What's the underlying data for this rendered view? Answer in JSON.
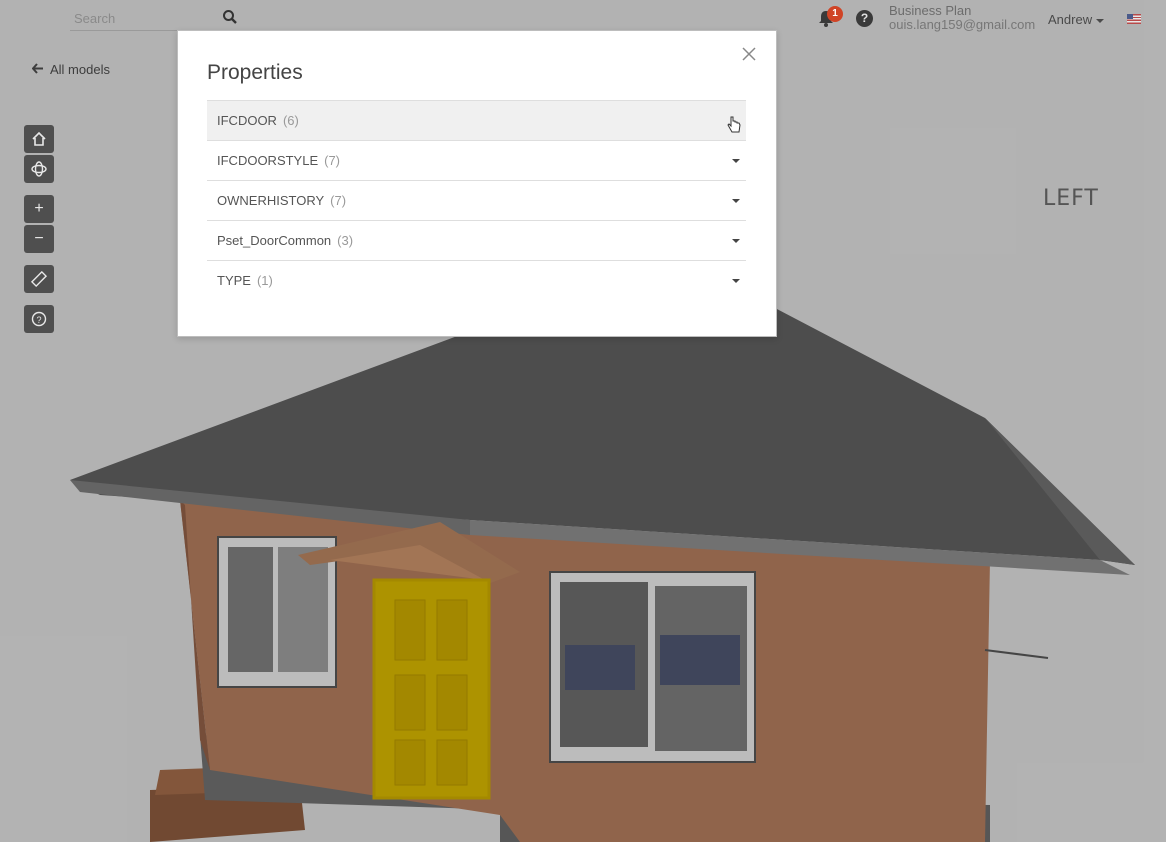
{
  "header": {
    "search_placeholder": "Search",
    "notification_count": "1",
    "help_label": "?",
    "account_title": "Business Plan",
    "account_email": "ouis.lang159@gmail.com",
    "user_name": "Andrew"
  },
  "nav": {
    "back_label": "All models"
  },
  "toolbar": {
    "zoom_in": "+",
    "zoom_out": "−",
    "help": "?"
  },
  "modal": {
    "title": "Properties",
    "rows": [
      {
        "name": "IFCDOOR",
        "count": "(6)"
      },
      {
        "name": "IFCDOORSTYLE",
        "count": "(7)"
      },
      {
        "name": "OWNERHISTORY",
        "count": "(7)"
      },
      {
        "name": "Pset_DoorCommon",
        "count": "(3)"
      },
      {
        "name": "TYPE",
        "count": "(1)"
      }
    ]
  },
  "viewcube": {
    "face_label": "LEFT"
  },
  "colors": {
    "wall": "#b07a5c",
    "roof": "#5e5e5e",
    "selected_door": "#d4b400",
    "badge": "#d04426"
  }
}
